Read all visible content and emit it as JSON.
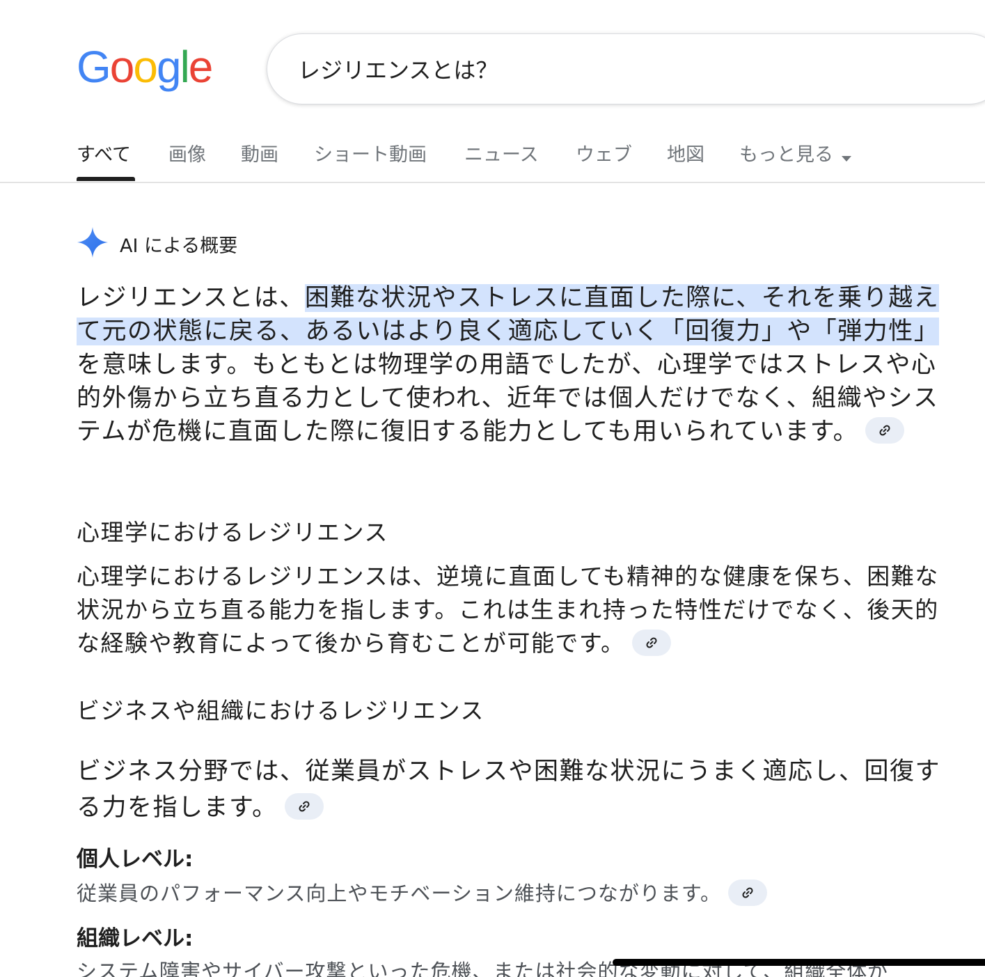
{
  "logo": {
    "letters": [
      "G",
      "o",
      "o",
      "g",
      "l",
      "e"
    ],
    "colors": [
      "#4285F4",
      "#EA4335",
      "#FBBC05",
      "#4285F4",
      "#34A853",
      "#EA4335"
    ]
  },
  "search": {
    "query": "レジリエンスとは？"
  },
  "tabs": [
    "すべて",
    "画像",
    "動画",
    "ショート動画",
    "ニュース",
    "ウェブ",
    "地図",
    "もっと見る"
  ],
  "ai_overview": {
    "label": "AI による概要",
    "intro_before": "レジリエンスとは、",
    "intro_highlight": "困難な状況やストレスに直面した際に、それを乗り越えて元の状態に戻る、あるいはより良く適応していく「回復力」や「弾力性」",
    "intro_after": "を意味します。もともとは物理学の用語でしたが、心理学ではストレスや心的外傷から立ち直る力として使われ、近年では個人だけでなく、組織やシステムが危機に直面した際に復旧する能力としても用いられています。",
    "section1_heading": "心理学におけるレジリエンス",
    "section1_text": "心理学におけるレジリエンスは、逆境に直面しても精神的な健康を保ち、困難な状況から立ち直る能力を指します。これは生まれ持った特性だけでなく、後天的な経験や教育によって後から育むことが可能です。",
    "section2_heading": "ビジネスや組織におけるレジリエンス",
    "section2_text": "ビジネス分野では、従業員がストレスや困難な状況にうまく適応し、回復する力を指します。",
    "individual_label": "個人レベル:",
    "individual_text": "従業員のパフォーマンス向上やモチベーション維持につながります。",
    "org_label": "組織レベル:",
    "org_text": "システム障害やサイバー攻撃といった危機、または社会的な変動に対して、組織全体が"
  }
}
